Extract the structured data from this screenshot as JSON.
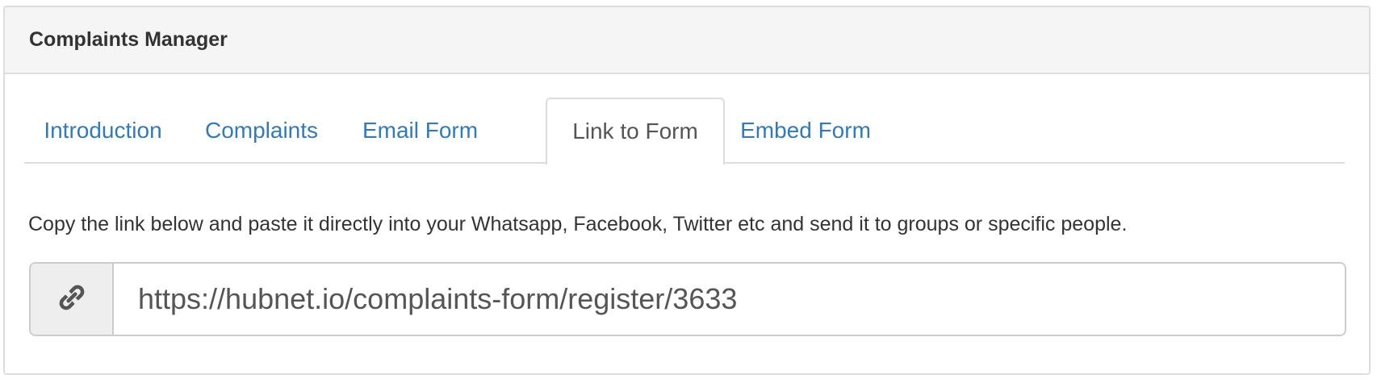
{
  "panel": {
    "title": "Complaints Manager"
  },
  "tabs": [
    {
      "label": "Introduction",
      "active": false
    },
    {
      "label": "Complaints",
      "active": false
    },
    {
      "label": "Email Form",
      "active": false
    },
    {
      "label": "Link to Form",
      "active": true
    },
    {
      "label": "Embed Form",
      "active": false
    }
  ],
  "content": {
    "description": "Copy the link below and paste it directly into your Whatsapp, Facebook, Twitter etc and send it to groups or specific people.",
    "link_value": "https://hubnet.io/complaints-form/register/3633",
    "link_icon": "link-icon"
  },
  "colors": {
    "tab_link": "#337ab7",
    "tab_active": "#555555",
    "heading_bg": "#f5f5f5",
    "addon_bg": "#eeeeee"
  }
}
